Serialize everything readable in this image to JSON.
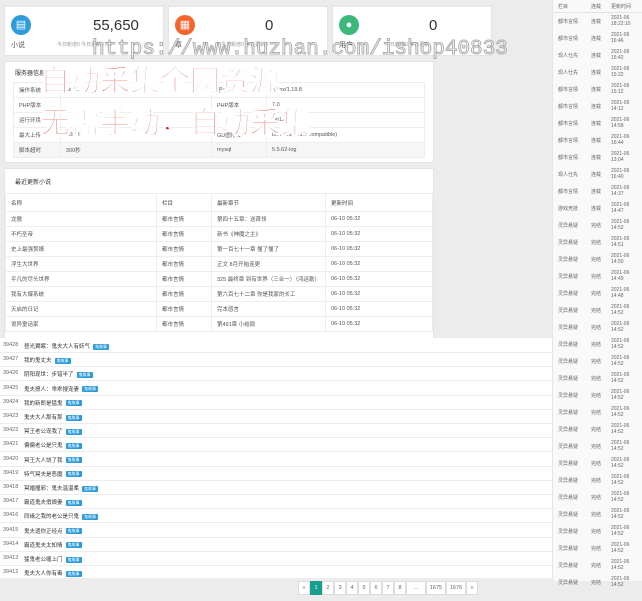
{
  "stats": [
    {
      "label": "小说",
      "value": "55,650",
      "sub": "今日新增0 今日更新0712",
      "color": "#2d9cdb",
      "icon": "book-icon"
    },
    {
      "label": "章",
      "value": "0",
      "sub": "今日新增0 今日更新0",
      "color": "#f5642d",
      "icon": "file-icon"
    },
    {
      "label": "用户",
      "value": "0",
      "sub": "今日新增0 今日更新",
      "color": "#3cb97a",
      "icon": "user-icon"
    }
  ],
  "server": {
    "title": "服务器信息",
    "rows": [
      [
        "操作系统",
        "Linux",
        "服务器",
        "nginx/1.19.8"
      ],
      [
        "PHP版本",
        "",
        "PHP版本",
        "7.0"
      ],
      [
        "运行环境",
        "",
        "",
        "vip123405.cn"
      ],
      [
        "最大上传",
        "500M",
        "GD图形库",
        "bundled (2.1.0 compatible)"
      ],
      [
        "脚本超时",
        "300秒",
        "mysql",
        "5.5.62-log"
      ]
    ]
  },
  "novels": {
    "title": "最近更新小说",
    "headers": [
      "名称",
      "栏目",
      "最新章节",
      "更新时间"
    ],
    "rows": [
      [
        "龙傲",
        "都市言情",
        "第四十五章：送首领",
        "06-10 05:32"
      ],
      [
        "不朽圣帝",
        "都市言情",
        "新书《神魔之主》",
        "06-10 05:32"
      ],
      [
        "史上最强赘婿",
        "都市言情",
        "第一百七十一章 懂了懂了",
        "06-10 05:32"
      ],
      [
        "浮生大世界",
        "都市言情",
        "正文 8月开始连更",
        "06-10 05:32"
      ],
      [
        "平凡的尽头世界",
        "都市言情",
        "325 最终章 到有世界（三合一）（鸿运勒）",
        "06-10 05:32"
      ],
      [
        "我有大爆系统",
        "都市言情",
        "第六百七十二章 你是我家的长工",
        "06-10 05:32"
      ],
      [
        "天启的日记",
        "都市言情",
        "完本感言",
        "06-10 05:32"
      ],
      [
        "诡异童话家",
        "都市言情",
        "第491章 小结局",
        "06-10 05:32"
      ]
    ]
  },
  "right": {
    "headers": [
      "栏目",
      "连载",
      "更新时间"
    ],
    "rows": [
      [
        "都市言情",
        "连载",
        "2021-06 18:22:10"
      ],
      [
        "都市言情",
        "连载",
        "2021-06 16:46"
      ],
      [
        "现人仕先",
        "连载",
        "2021-06 15:42"
      ],
      [
        "现人仕先",
        "连载",
        "2021-06 15:22"
      ],
      [
        "都市言情",
        "连载",
        "2021-06 15:12"
      ],
      [
        "都市言情",
        "连载",
        "2021-06 14:12"
      ],
      [
        "都市言情",
        "连载",
        "2021-06 14:58"
      ],
      [
        "都市言情",
        "连载",
        "2021-06 16:44"
      ],
      [
        "都市言情",
        "连载",
        "2021-06 13:04"
      ],
      [
        "现人仕先",
        "连载",
        "2021-06 16:40"
      ],
      [
        "都市言情",
        "连载",
        "2021-06 14:37"
      ],
      [
        "游戏竞技",
        "连载",
        "2021-06 14:47"
      ],
      [
        "灵异悬疑",
        "完结",
        "2021-06 14:52"
      ],
      [
        "灵异悬疑",
        "完结",
        "2021-06 14:51"
      ],
      [
        "灵异悬疑",
        "完结",
        "2021-06 14:50"
      ],
      [
        "灵异悬疑",
        "完结",
        "2021-06 14:49"
      ],
      [
        "灵异悬疑",
        "完结",
        "2021-06 14:48"
      ],
      [
        "灵异悬疑",
        "完结",
        "2021-06 14:52"
      ],
      [
        "灵异悬疑",
        "完结",
        "2021-06 14:52"
      ],
      [
        "灵异悬疑",
        "完结",
        "2021-06 14:52"
      ],
      [
        "灵异悬疑",
        "完结",
        "2021-06 14:52"
      ],
      [
        "灵异悬疑",
        "完结",
        "2021-06 14:52"
      ],
      [
        "灵异悬疑",
        "完结",
        "2021-06 14:52"
      ],
      [
        "灵异悬疑",
        "完结",
        "2021-06 14:52"
      ],
      [
        "灵异悬疑",
        "完结",
        "2021-06 14:52"
      ],
      [
        "灵异悬疑",
        "完结",
        "2021-06 14:52"
      ],
      [
        "灵异悬疑",
        "完结",
        "2021-06 14:52"
      ],
      [
        "灵异悬疑",
        "完结",
        "2021-06 14:52"
      ],
      [
        "灵异悬疑",
        "完结",
        "2021-06 14:52"
      ],
      [
        "灵异悬疑",
        "完结",
        "2021-06 14:52"
      ],
      [
        "灵异悬疑",
        "完结",
        "2021-06 14:52"
      ],
      [
        "灵异悬疑",
        "完结",
        "2021-06 14:52"
      ],
      [
        "灵异悬疑",
        "完结",
        "2021-06 14:52"
      ],
      [
        "灵异悬疑",
        "完结",
        "2021-06 14:52"
      ]
    ]
  },
  "chapters": [
    {
      "id": "39428",
      "title": "昼光翼眠：鬼夫大人有妖气"
    },
    {
      "id": "39427",
      "title": "我的鬼丈夫"
    },
    {
      "id": "39426",
      "title": "阴阳现世：步错半了"
    },
    {
      "id": "39425",
      "title": "鬼夫撩人：乖乖搜宠妻"
    },
    {
      "id": "39424",
      "title": "我的新郎是猛鬼"
    },
    {
      "id": "39423",
      "title": "鬼夫大人那有那"
    },
    {
      "id": "39422",
      "title": "冥王老公宠我了"
    },
    {
      "id": "39421",
      "title": "偏偏老公是只鬼"
    },
    {
      "id": "39420",
      "title": "冥王大人饶了我"
    },
    {
      "id": "39419",
      "title": "特气冥夫是恶魔"
    },
    {
      "id": "39418",
      "title": "冥婚撞邪：鬼夫温温柔"
    },
    {
      "id": "39417",
      "title": "霸道鬼夫俏娘妻"
    },
    {
      "id": "39416",
      "title": "同缘之我的老公是只鬼"
    },
    {
      "id": "39415",
      "title": "鬼夫遗你正经点"
    },
    {
      "id": "39414",
      "title": "霸道鬼夫太知情"
    },
    {
      "id": "39413",
      "title": "猛鬼老公缠上门"
    },
    {
      "id": "39412",
      "title": "鬼夫大人你有毒"
    }
  ],
  "chapter_badge": "鬼故事",
  "pagination": [
    "«",
    "1",
    "2",
    "3",
    "4",
    "5",
    "6",
    "7",
    "8",
    "...",
    "1675",
    "1676",
    "»"
  ],
  "pagination_active": 1,
  "watermark": "https://www.huzhan.com/ishop40833",
  "promo1": "自动采集全网资源",
  "promo2": "无需手动，自动采集"
}
